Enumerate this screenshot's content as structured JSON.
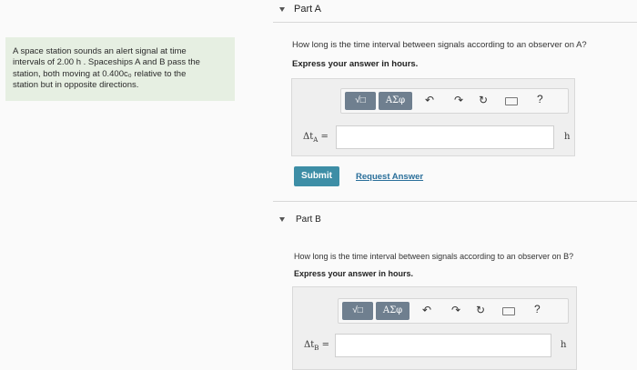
{
  "problem": {
    "lines": [
      "A space station sounds an alert signal at time",
      "intervals of 2.00 h . Spaceships A and B pass the",
      "station, both moving at 0.400c₀ relative to the",
      "station but in opposite directions."
    ]
  },
  "toolbar": {
    "template_label": "√□",
    "symbols_label": "ΑΣφ",
    "undo_icon": "↶",
    "redo_icon": "↷",
    "reset_icon": "↻",
    "help_label": "?"
  },
  "partA": {
    "title": "Part A",
    "question": "How long is the time interval between signals according to an observer on A?",
    "instruction": "Express your answer in hours.",
    "var_label": "Δt",
    "var_sub": "A",
    "eq": "=",
    "unit": "h",
    "value": "",
    "submit_label": "Submit",
    "request_label": "Request Answer"
  },
  "partB": {
    "title": "Part B",
    "question": "How long is the time interval between signals according to an observer on B?",
    "instruction": "Express your answer in hours.",
    "var_label": "Δt",
    "var_sub": "B",
    "eq": "=",
    "unit": "h",
    "value": ""
  }
}
